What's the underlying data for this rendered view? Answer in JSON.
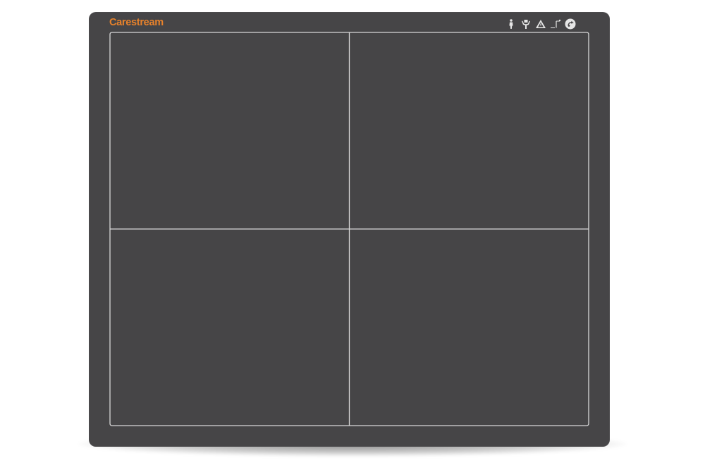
{
  "device": {
    "brand_label": "Carestream",
    "brand_color": "#e8822b",
    "panel_color": "#464547",
    "line_color": "#d8d8d8"
  },
  "status_icons": [
    {
      "name": "person-icon"
    },
    {
      "name": "hands-icon"
    },
    {
      "name": "warning-triangle-icon"
    },
    {
      "name": "weight-limit-icon"
    },
    {
      "name": "recycle-badge-icon"
    }
  ],
  "detector_grid": {
    "rows": 2,
    "columns": 2
  }
}
